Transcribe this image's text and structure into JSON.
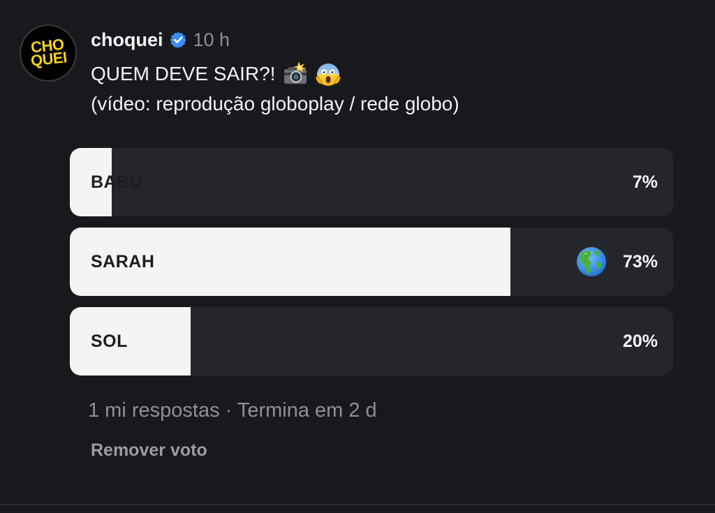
{
  "post": {
    "account_logo_text": [
      "CHO",
      "QUEI"
    ],
    "username": "choquei",
    "timestamp": "10 h",
    "text_line1": "QUEM DEVE SAIR?!",
    "text_line2": "(vídeo: reprodução globoplay / rede globo)",
    "emojis": [
      "camera-with-flash",
      "face-screaming-in-fear"
    ]
  },
  "poll": {
    "options": [
      {
        "label": "BABU",
        "percent_text": "7%",
        "percent": 7,
        "selected": false
      },
      {
        "label": "SARAH",
        "percent_text": "73%",
        "percent": 73,
        "selected": true,
        "icon": "globe-americas"
      },
      {
        "label": "SOL",
        "percent_text": "20%",
        "percent": 20,
        "selected": false
      }
    ],
    "meta": "1 mi respostas · Termina em 2 d",
    "remove_vote_label": "Remover voto"
  },
  "colors": {
    "background": "#18191c",
    "bar_track": "#25262b",
    "bar_fill": "#f4f5f3",
    "verified": "#3b8cf5",
    "logo_yellow": "#f7d417",
    "muted_text": "#8d9099"
  }
}
